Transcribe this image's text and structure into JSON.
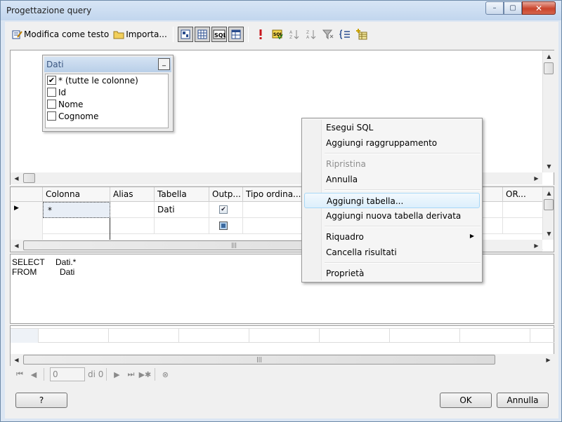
{
  "window": {
    "title": "Progettazione query",
    "minimize_label": "–",
    "maximize_label": "▢",
    "close_label": "✕"
  },
  "toolbar": {
    "edit_text_label": "Modifica come testo",
    "import_label": "Importa..."
  },
  "diagram": {
    "table": {
      "name": "Dati",
      "minimize_glyph": "_",
      "columns": [
        {
          "label": "* (tutte le colonne)",
          "checked": true
        },
        {
          "label": "Id",
          "checked": false
        },
        {
          "label": "Nome",
          "checked": false
        },
        {
          "label": "Cognome",
          "checked": false
        }
      ]
    }
  },
  "grid": {
    "headers": [
      "Colonna",
      "Alias",
      "Tabella",
      "Outp...",
      "Tipo ordina...",
      "OR..."
    ],
    "rows": [
      {
        "column": "*",
        "alias": "",
        "table": "Dati",
        "output": "checked"
      }
    ]
  },
  "sql": {
    "line1_keyword": "SELECT",
    "line1_value": "Dati.*",
    "line2_keyword": "FROM",
    "line2_value": "Dati"
  },
  "navigation": {
    "page_value": "0",
    "of_label": "di 0"
  },
  "buttons": {
    "help": "?",
    "ok": "OK",
    "cancel": "Annulla"
  },
  "context_menu": {
    "items": [
      {
        "label": "Esegui SQL"
      },
      {
        "label": "Aggiungi raggruppamento"
      },
      {
        "label": "Ripristina"
      },
      {
        "label": "Annulla"
      },
      {
        "label": "Aggiungi tabella..."
      },
      {
        "label": "Aggiungi nuova tabella derivata"
      },
      {
        "label": "Riquadro"
      },
      {
        "label": "Cancella risultati"
      },
      {
        "label": "Proprietà"
      }
    ]
  },
  "colors": {
    "accent": "#3b6aa0",
    "menu_hover": "#dceffc"
  }
}
